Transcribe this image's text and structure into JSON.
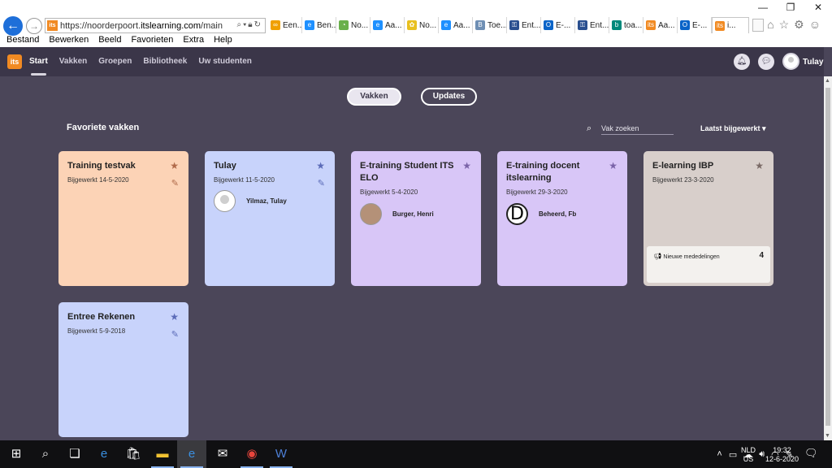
{
  "browser": {
    "url_prefix": "https://noorderpoort.",
    "url_domain": "itslearning.com",
    "url_path": "/main.aspx?Te",
    "tabs": [
      {
        "label": "Een...",
        "icon_color": "#f0a000",
        "icon": "∞"
      },
      {
        "label": "Ben...",
        "icon_color": "#1e90ff",
        "icon": "e"
      },
      {
        "label": "No...",
        "icon_color": "#6ab04c",
        "icon": "◔"
      },
      {
        "label": "Aa...",
        "icon_color": "#1e90ff",
        "icon": "e"
      },
      {
        "label": "No...",
        "icon_color": "#e8c020",
        "icon": "✿"
      },
      {
        "label": "Aa...",
        "icon_color": "#1e90ff",
        "icon": "e"
      },
      {
        "label": "Toe...",
        "icon_color": "#6f8fb4",
        "icon": "B"
      },
      {
        "label": "Ent...",
        "icon_color": "#2a4f8f",
        "icon": "⚿"
      },
      {
        "label": "E-...",
        "icon_color": "#0a64c8",
        "icon": "O"
      },
      {
        "label": "Ent...",
        "icon_color": "#2a4f8f",
        "icon": "⚿"
      },
      {
        "label": "toa...",
        "icon_color": "#00897b",
        "icon": "b"
      },
      {
        "label": "Aa...",
        "icon_color": "#f18a22",
        "icon": "its"
      },
      {
        "label": "E-...",
        "icon_color": "#0a64c8",
        "icon": "O"
      },
      {
        "label": "i...",
        "icon_color": "#f18a22",
        "icon": "its"
      }
    ],
    "menu": [
      "Bestand",
      "Bewerken",
      "Beeld",
      "Favorieten",
      "Extra",
      "Help"
    ]
  },
  "app": {
    "logo": "its",
    "nav": [
      "Start",
      "Vakken",
      "Groepen",
      "Bibliotheek",
      "Uw studenten"
    ],
    "user_name": "Tulay",
    "toggle": {
      "left": "Vakken",
      "right": "Updates"
    },
    "favorites_title": "Favoriete vakken",
    "search_placeholder": "Vak zoeken",
    "sort_label": "Laatst bijgewerkt ▾",
    "cards": [
      {
        "title": "Training testvak",
        "updated": "Bijgewerkt 14-5-2020",
        "color": "#fcd3b6",
        "star_color": "#b06a4a",
        "edit": true,
        "owner": null
      },
      {
        "title": "Tulay",
        "updated": "Bijgewerkt 11-5-2020",
        "color": "#c8d3fb",
        "star_color": "#5b6bb8",
        "edit": true,
        "owner": {
          "name": "Yilmaz, Tulay",
          "kind": "blank"
        }
      },
      {
        "title": "E-training Student ITS ELO",
        "updated": "Bijgewerkt 5-4-2020",
        "color": "#d8c6f7",
        "star_color": "#7a63a8",
        "edit": false,
        "owner": {
          "name": "Burger, Henri",
          "kind": "photo"
        }
      },
      {
        "title": "E-training docent itslearning",
        "updated": "Bijgewerkt 29-3-2020",
        "color": "#d8c6f7",
        "star_color": "#7a63a8",
        "edit": false,
        "owner": {
          "name": "Beheerd, Fb",
          "kind": "letter",
          "letter": "D"
        }
      },
      {
        "title": "E-learning IBP",
        "updated": "Bijgewerkt 23-3-2020",
        "color": "#d8cfcb",
        "star_color": "#7a6a66",
        "edit": false,
        "owner": null,
        "notice": {
          "label": "Nieuwe mededelingen",
          "count": "4"
        }
      },
      {
        "title": "Entree Rekenen",
        "updated": "Bijgewerkt 5-9-2018",
        "color": "#c8d3fb",
        "star_color": "#5b6bb8",
        "edit": true,
        "owner": null
      }
    ]
  },
  "taskbar": {
    "lang": [
      "NLD",
      "US"
    ],
    "time": "19:32",
    "date": "12-6-2020"
  }
}
